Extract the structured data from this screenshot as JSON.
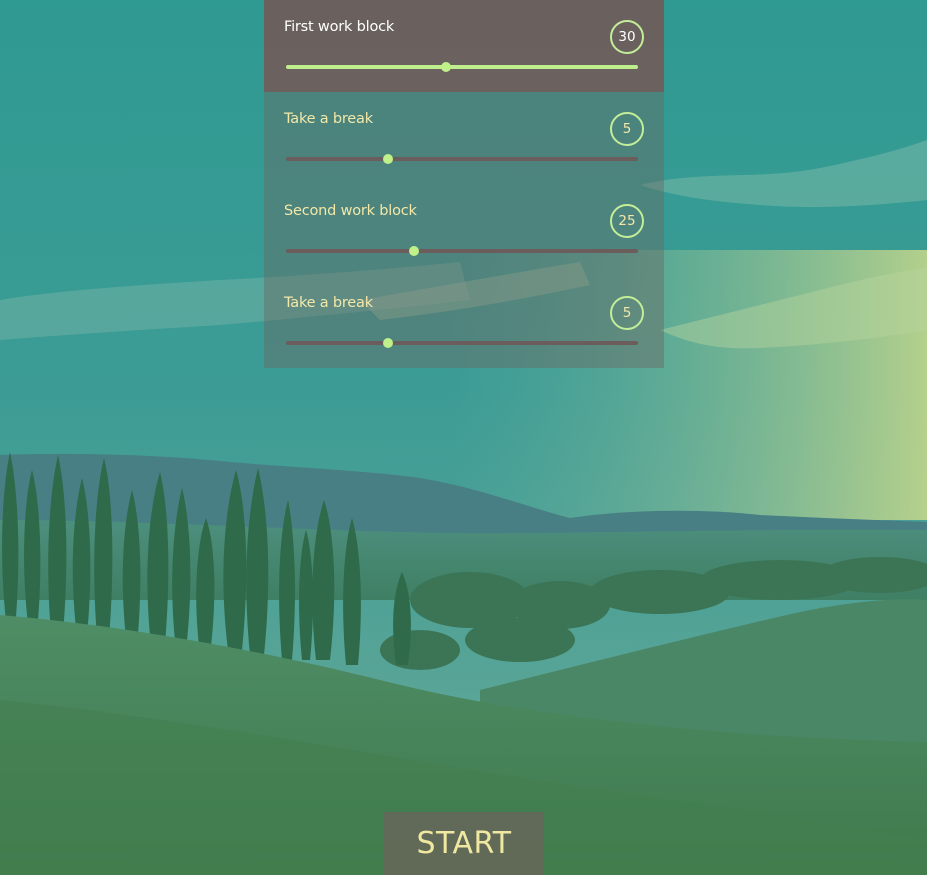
{
  "blocks": [
    {
      "label": "First work block",
      "value": "30",
      "level": 0.455,
      "active": true
    },
    {
      "label": "Take a break",
      "value": "5",
      "level": 0.29,
      "active": false
    },
    {
      "label": "Second work block",
      "value": "25",
      "level": 0.365,
      "active": false
    },
    {
      "label": "Take a break",
      "value": "5",
      "level": 0.29,
      "active": false
    }
  ],
  "start_label": "START",
  "colors": {
    "accent": "#bff08a",
    "label_text": "#f2e8a8",
    "active_panel": "#705c5a",
    "track": "#6b5d5b"
  }
}
